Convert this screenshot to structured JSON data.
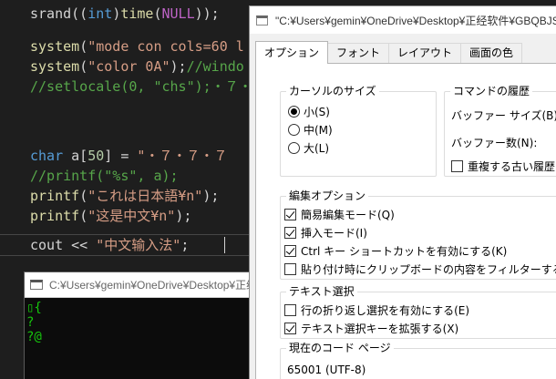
{
  "editor": {
    "lines": [
      {
        "parts": [
          {
            "t": "srand((",
            "c": ""
          },
          {
            "t": "int",
            "c": "kw"
          },
          {
            "t": ")",
            "c": ""
          },
          {
            "t": "time",
            "c": "fn"
          },
          {
            "t": "(",
            "c": ""
          },
          {
            "t": "NULL",
            "c": "mac"
          },
          {
            "t": "));",
            "c": ""
          }
        ]
      },
      {
        "parts": [
          {
            "t": "system",
            "c": "fn"
          },
          {
            "t": "(",
            "c": ""
          },
          {
            "t": "\"mode con cols=60 l",
            "c": "str"
          }
        ]
      },
      {
        "parts": [
          {
            "t": "system",
            "c": "fn"
          },
          {
            "t": "(",
            "c": ""
          },
          {
            "t": "\"color 0A\"",
            "c": "str"
          },
          {
            "t": ");",
            "c": ""
          },
          {
            "t": "//windo",
            "c": "cm"
          }
        ]
      },
      {
        "parts": [
          {
            "t": "//setlocale(0, \"chs\");・７・",
            "c": "cm"
          }
        ]
      },
      {
        "parts": [
          {
            "t": "char",
            "c": "kw"
          },
          {
            "t": " a[",
            "c": ""
          },
          {
            "t": "50",
            "c": "nm"
          },
          {
            "t": "] = ",
            "c": ""
          },
          {
            "t": "\"・７・７・７",
            "c": "str"
          }
        ]
      },
      {
        "parts": [
          {
            "t": "//printf(\"%s\", a);",
            "c": "cm"
          }
        ]
      },
      {
        "parts": [
          {
            "t": "printf",
            "c": "fn"
          },
          {
            "t": "(",
            "c": ""
          },
          {
            "t": "\"これは日本語¥n\"",
            "c": "str"
          },
          {
            "t": ");",
            "c": ""
          }
        ]
      },
      {
        "parts": [
          {
            "t": "printf",
            "c": "fn"
          },
          {
            "t": "(",
            "c": ""
          },
          {
            "t": "\"这是中文¥n\"",
            "c": "str"
          },
          {
            "t": ");",
            "c": ""
          }
        ]
      },
      {
        "parts": [
          {
            "t": "cout << ",
            "c": ""
          },
          {
            "t": "\"中文输入法\"",
            "c": "str"
          },
          {
            "t": ";",
            "c": ""
          }
        ]
      }
    ]
  },
  "console": {
    "title": "C:¥Users¥gemin¥OneDrive¥Desktop¥正经",
    "output": [
      "▯{",
      "?",
      "?@"
    ]
  },
  "dialog": {
    "title": "\"C:¥Users¥gemin¥OneDrive¥Desktop¥正经软件¥GBQBJSZ¥",
    "tabs": [
      "オプション",
      "フォント",
      "レイアウト",
      "画面の色"
    ],
    "cursor_size": {
      "legend": "カーソルのサイズ",
      "options": [
        "小(S)",
        "中(M)",
        "大(L)"
      ],
      "selected": "小(S)"
    },
    "history": {
      "legend": "コマンドの履歴",
      "buffer_size_label": "バッファー サイズ(B):",
      "buffer_count_label": "バッファー数(N):",
      "discard_dup_label": "重複する古い履歴を破"
    },
    "edit_options": {
      "legend": "編集オプション",
      "items": [
        {
          "label": "簡易編集モード(Q)",
          "checked": true
        },
        {
          "label": "挿入モード(I)",
          "checked": true
        },
        {
          "label": "Ctrl キー ショートカットを有効にする(K)",
          "checked": true
        },
        {
          "label": "貼り付け時にクリップボードの内容をフィルターする(F)",
          "checked": false
        }
      ]
    },
    "text_selection": {
      "legend": "テキスト選択",
      "items": [
        {
          "label": "行の折り返し選択を有効にする(E)",
          "checked": false
        },
        {
          "label": "テキスト選択キーを拡張する(X)",
          "checked": true
        }
      ]
    },
    "code_page": {
      "legend": "現在のコード ページ",
      "value": "65001 (UTF-8)"
    }
  }
}
